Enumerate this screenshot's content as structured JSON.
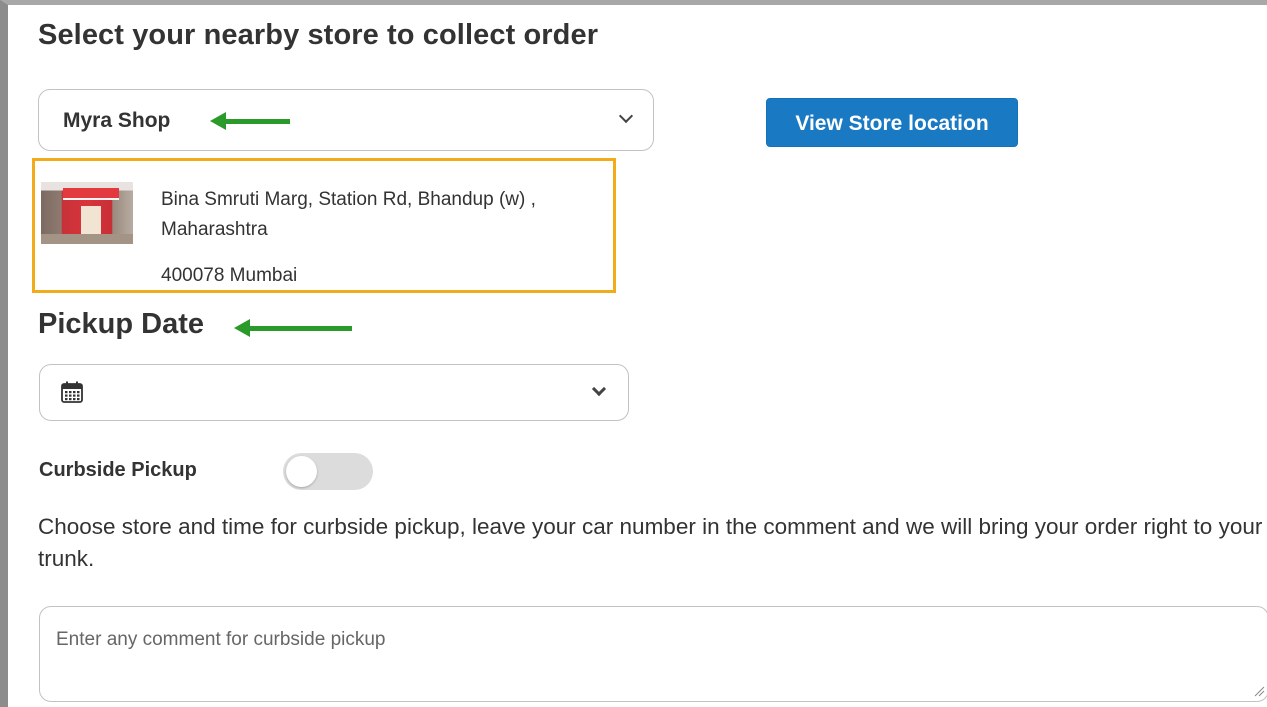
{
  "store_section": {
    "heading": "Select your nearby store to collect order",
    "selected_store": "Myra Shop",
    "view_button_label": "View Store location",
    "store": {
      "address_line1": "Bina Smruti Marg, Station Rd, Bhandup (w) ,",
      "address_line2": "Maharashtra",
      "address_line3": "400078 Mumbai"
    }
  },
  "pickup_date": {
    "heading": "Pickup Date",
    "value": ""
  },
  "curbside": {
    "label": "Curbside Pickup",
    "enabled": false,
    "description": "Choose store and time for curbside pickup, leave your car number in the comment and we will bring your order right to your trunk.",
    "comment_placeholder": "Enter any comment for curbside pickup",
    "comment_value": ""
  },
  "colors": {
    "primary_button": "#1979c3",
    "highlight_border": "#f2ab1b",
    "annotation_arrow": "#2a9a2a",
    "toggle_off": "#dcdcdc"
  },
  "icons": {
    "store_select_chevron": "chevron-down-icon",
    "date_icon": "calendar-icon",
    "date_chevron": "chevron-down-icon",
    "arrow": "left-arrow-icon"
  }
}
